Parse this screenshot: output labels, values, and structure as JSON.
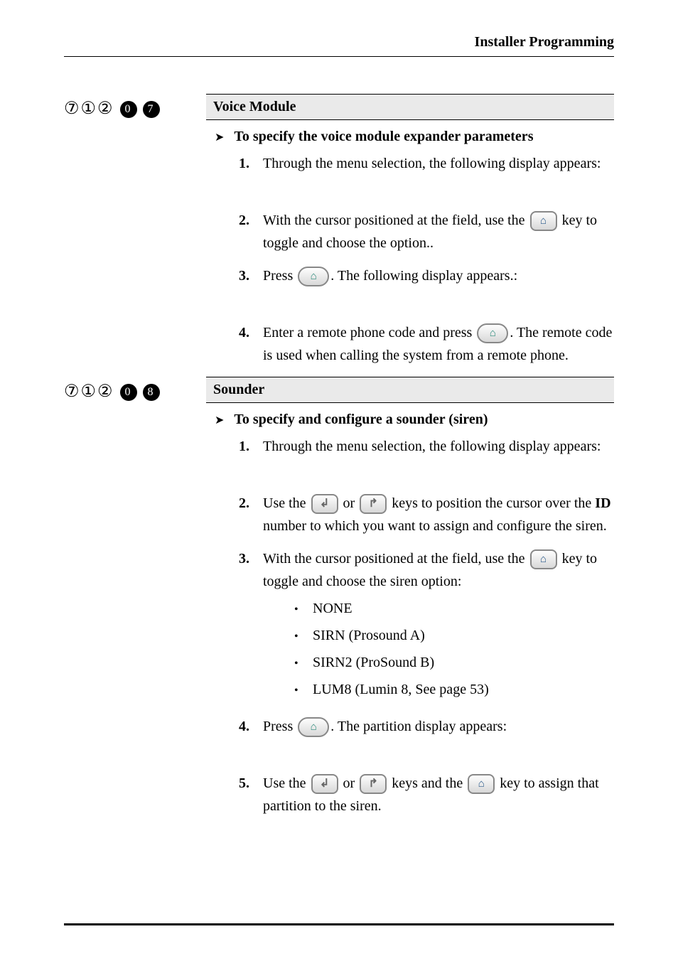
{
  "header": {
    "title": "Installer Programming"
  },
  "sections": [
    {
      "numbers": "⑦①②",
      "filled": [
        "0",
        "7"
      ],
      "title": "Voice Module",
      "heading": "To specify the voice module expander parameters",
      "steps": [
        {
          "n": "1.",
          "pre": "Through the menu selection, the following display appears:",
          "spacerAfter": true
        },
        {
          "n": "2.",
          "pre": "With the cursor positioned at the ",
          "mid": " field, use the ",
          "icon1": "house",
          "post": " key to toggle and choose the ",
          "tail": " option.."
        },
        {
          "n": "3.",
          "pre": "Press ",
          "icon1": "house-teal-oval",
          "post": ". The following display appears.:",
          "spacerAfter": true
        },
        {
          "n": "4.",
          "pre": "Enter a remote phone code and press ",
          "icon1": "house-teal-oval",
          "post": ". The remote code is used when calling the system from a remote phone."
        }
      ]
    },
    {
      "numbers": "⑦①②",
      "filled": [
        "0",
        "8"
      ],
      "title": "Sounder",
      "heading": "To specify and configure a sounder (siren)",
      "steps": [
        {
          "n": "1.",
          "pre": "Through the menu selection, the following display appears:",
          "spacerAfter": true
        },
        {
          "n": "2.",
          "pre": "Use the ",
          "icon1": "enter",
          "mid": " or ",
          "icon2": "arrowup",
          "post": " keys to position the cursor over the ",
          "bold": "ID",
          "tail": " number to which you want to assign and configure the siren."
        },
        {
          "n": "3.",
          "pre": "With the cursor positioned at the ",
          "mid": " field, use the ",
          "icon1": "house",
          "post": " key to toggle and choose the siren option:",
          "bullets": [
            "NONE",
            "SIRN (Prosound A)",
            "SIRN2 (ProSound B)",
            "LUM8 (Lumin 8, See page 53)"
          ]
        },
        {
          "n": "4.",
          "pre": "Press ",
          "icon1": "house-teal-oval",
          "post": ". The partition display appears:",
          "spacerAfter": true
        },
        {
          "n": "5.",
          "pre": "Use the ",
          "icon1": "enter",
          "mid": " or ",
          "icon2": "arrowup",
          "post": " keys and the ",
          "icon3": "house",
          "tail": " key to assign that partition to the siren."
        }
      ]
    }
  ]
}
